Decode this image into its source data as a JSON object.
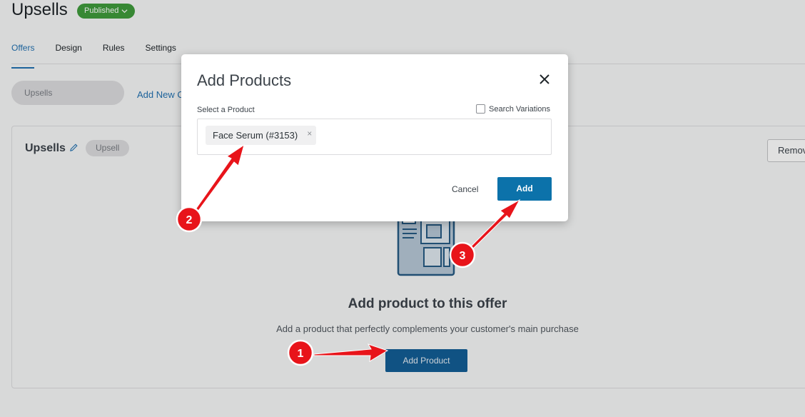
{
  "header": {
    "title": "Upsells",
    "status": "Published"
  },
  "tabs": [
    {
      "label": "Offers",
      "active": true
    },
    {
      "label": "Design",
      "active": false
    },
    {
      "label": "Rules",
      "active": false
    },
    {
      "label": "Settings",
      "active": false
    }
  ],
  "offers": {
    "current_offer": "Upsells",
    "add_new_label": "Add New O"
  },
  "card": {
    "title": "Upsells",
    "tag": "Upsell",
    "remove_label": "Remov",
    "empty_title": "Add product to this offer",
    "empty_subtitle": "Add a product that perfectly complements your customer's main purchase",
    "add_product_label": "Add Product"
  },
  "modal": {
    "title": "Add Products",
    "field_label": "Select a Product",
    "search_variations_label": "Search Variations",
    "search_variations_checked": false,
    "selected_product": "Face Serum (#3153)",
    "chip_remove_glyph": "×",
    "cancel_label": "Cancel",
    "add_label": "Add"
  },
  "annotations": {
    "step1": "1",
    "step2": "2",
    "step3": "3"
  },
  "colors": {
    "primary": "#0c72aa",
    "status_green": "#3f9b3c",
    "annotation_red": "#e8141a",
    "link": "#2271b1"
  }
}
